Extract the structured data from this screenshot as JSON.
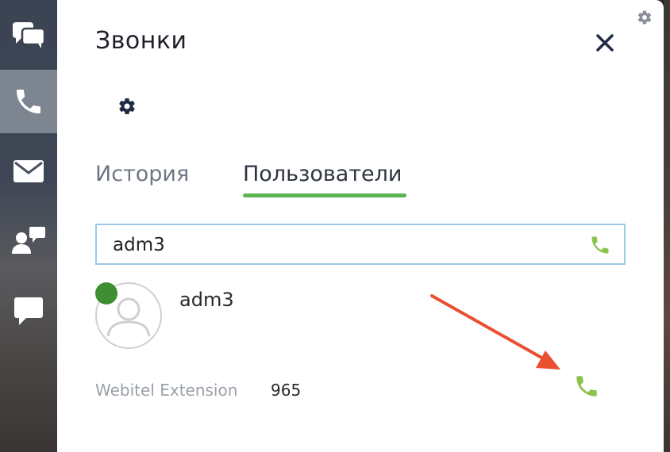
{
  "header": {
    "title": "Звонки"
  },
  "sidebar": {
    "items": [
      {
        "icon": "chats-icon",
        "active": false
      },
      {
        "icon": "phone-icon",
        "active": true
      },
      {
        "icon": "mail-icon",
        "active": false
      },
      {
        "icon": "contacts-icon",
        "active": false
      },
      {
        "icon": "message-icon",
        "active": false
      }
    ]
  },
  "tabs": [
    {
      "label": "История",
      "active": false
    },
    {
      "label": "Пользователи",
      "active": true
    }
  ],
  "search": {
    "value": "adm3"
  },
  "user": {
    "name": "adm3",
    "status_color": "#3d8f32",
    "extension_label": "Webitel Extension",
    "extension_value": "965"
  },
  "colors": {
    "accent_green": "#5ab552",
    "call_green": "#8bc34a",
    "annotation_red": "#e8502f",
    "active_sidebar": "#7d8590"
  }
}
